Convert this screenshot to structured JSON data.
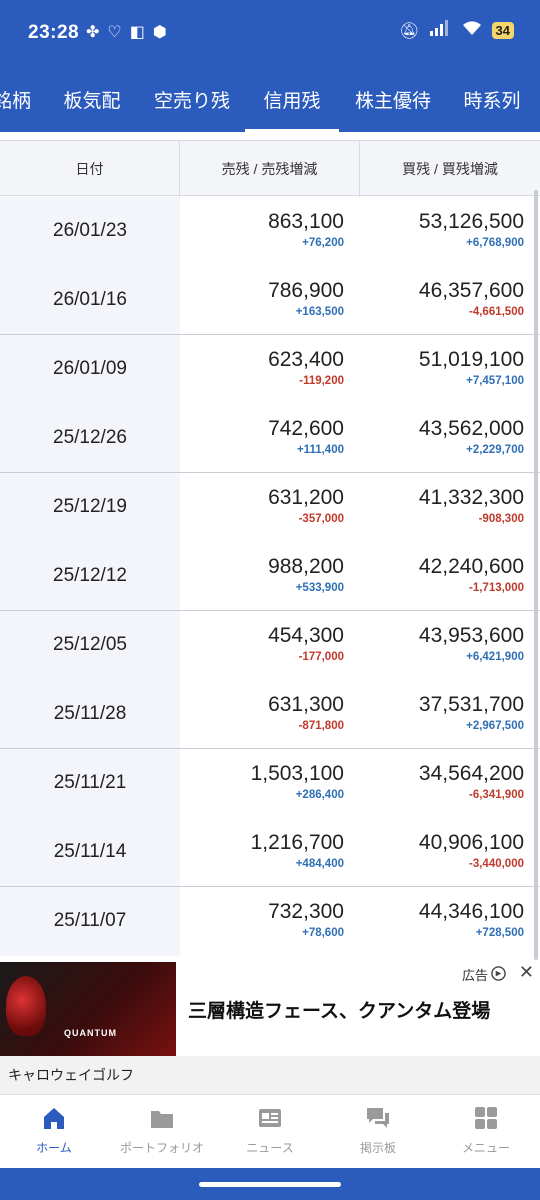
{
  "status_bar": {
    "time": "23:28",
    "battery": "34"
  },
  "tabs": [
    {
      "label": "銘柄"
    },
    {
      "label": "板気配"
    },
    {
      "label": "空売り残"
    },
    {
      "label": "信用残",
      "active": true
    },
    {
      "label": "株主優待"
    },
    {
      "label": "時系列"
    }
  ],
  "table": {
    "headers": {
      "date": "日付",
      "sell": "売残 / 売残増減",
      "buy": "買残 / 買残増減"
    },
    "rows": [
      {
        "date": "26/01/23",
        "sell": "863,100",
        "sell_delta": "+76,200",
        "buy": "53,126,500",
        "buy_delta": "+6,768,900"
      },
      {
        "date": "26/01/16",
        "sell": "786,900",
        "sell_delta": "+163,500",
        "buy": "46,357,600",
        "buy_delta": "-4,661,500"
      },
      {
        "date": "26/01/09",
        "sell": "623,400",
        "sell_delta": "-119,200",
        "buy": "51,019,100",
        "buy_delta": "+7,457,100"
      },
      {
        "date": "25/12/26",
        "sell": "742,600",
        "sell_delta": "+111,400",
        "buy": "43,562,000",
        "buy_delta": "+2,229,700"
      },
      {
        "date": "25/12/19",
        "sell": "631,200",
        "sell_delta": "-357,000",
        "buy": "41,332,300",
        "buy_delta": "-908,300"
      },
      {
        "date": "25/12/12",
        "sell": "988,200",
        "sell_delta": "+533,900",
        "buy": "42,240,600",
        "buy_delta": "-1,713,000"
      },
      {
        "date": "25/12/05",
        "sell": "454,300",
        "sell_delta": "-177,000",
        "buy": "43,953,600",
        "buy_delta": "+6,421,900"
      },
      {
        "date": "25/11/28",
        "sell": "631,300",
        "sell_delta": "-871,800",
        "buy": "37,531,700",
        "buy_delta": "+2,967,500"
      },
      {
        "date": "25/11/21",
        "sell": "1,503,100",
        "sell_delta": "+286,400",
        "buy": "34,564,200",
        "buy_delta": "-6,341,900"
      },
      {
        "date": "25/11/14",
        "sell": "1,216,700",
        "sell_delta": "+484,400",
        "buy": "40,906,100",
        "buy_delta": "-3,440,000"
      },
      {
        "date": "25/11/07",
        "sell": "732,300",
        "sell_delta": "+78,600",
        "buy": "44,346,100",
        "buy_delta": "+728,500"
      }
    ]
  },
  "ad": {
    "label": "広告",
    "headline": "三層構造フェース、クアンタム登場",
    "image_text_1": "",
    "image_text_2": "QUANTUM",
    "sponsor": "キャロウェイゴルフ"
  },
  "bottom_nav": [
    {
      "label": "ホーム",
      "icon": "home-icon",
      "active": true
    },
    {
      "label": "ポートフォリオ",
      "icon": "folder-icon"
    },
    {
      "label": "ニュース",
      "icon": "news-icon"
    },
    {
      "label": "掲示板",
      "icon": "chat-icon"
    },
    {
      "label": "メニュー",
      "icon": "grid-icon"
    }
  ],
  "colors": {
    "brand": "#2b5bbd",
    "positive": "#2f6fb5",
    "negative": "#c0392b"
  }
}
